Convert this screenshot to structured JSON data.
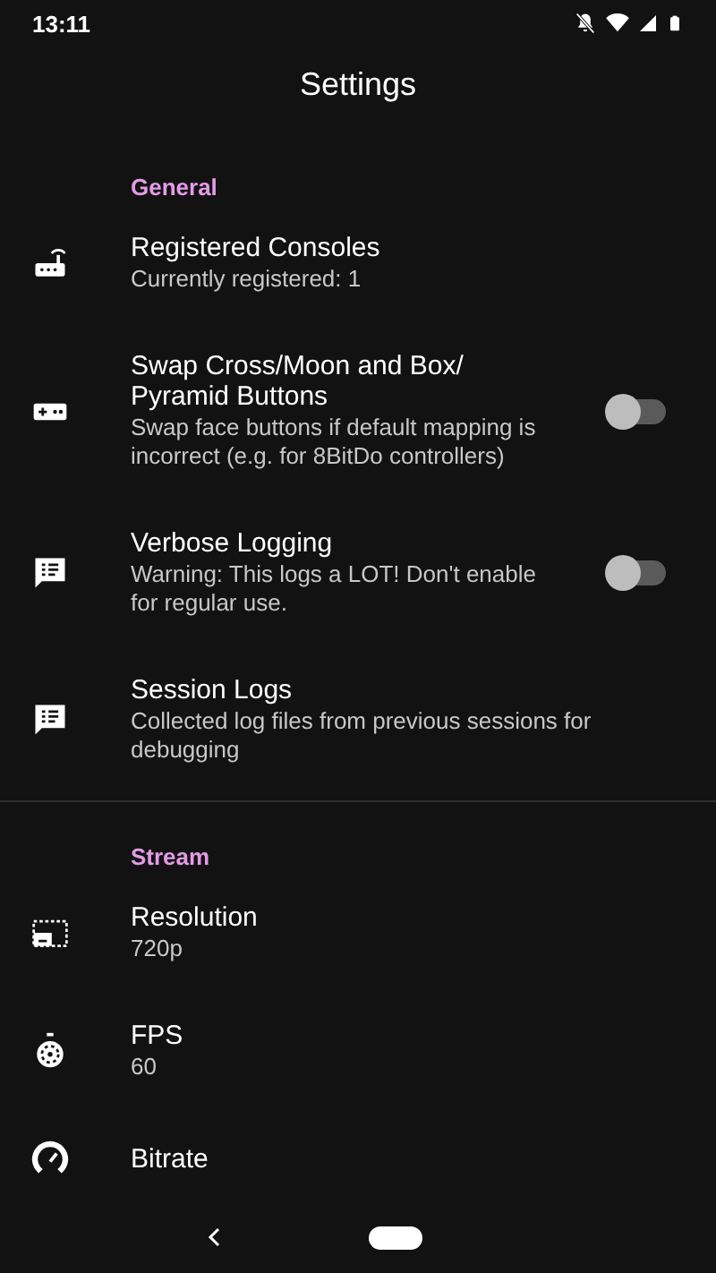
{
  "status_bar": {
    "time": "13:11"
  },
  "header": {
    "title": "Settings"
  },
  "sections": [
    {
      "title": "General",
      "items": [
        {
          "kind": "plain",
          "title": "Registered Consoles",
          "summary": "Currently registered: 1"
        },
        {
          "kind": "toggle",
          "title": "Swap Cross/Moon and Box/ Pyramid Buttons",
          "summary": "Swap face buttons if default mapping is incorrect (e.g. for 8BitDo controllers)",
          "on": false
        },
        {
          "kind": "toggle",
          "title": "Verbose Logging",
          "summary": "Warning: This logs a LOT! Don't enable for regular use.",
          "on": false
        },
        {
          "kind": "plain",
          "title": "Session Logs",
          "summary": "Collected log files from previous sessions for debugging"
        }
      ]
    },
    {
      "title": "Stream",
      "items": [
        {
          "kind": "plain",
          "title": "Resolution",
          "summary": "720p"
        },
        {
          "kind": "plain",
          "title": "FPS",
          "summary": "60"
        },
        {
          "kind": "plain",
          "title": "Bitrate"
        }
      ]
    }
  ]
}
